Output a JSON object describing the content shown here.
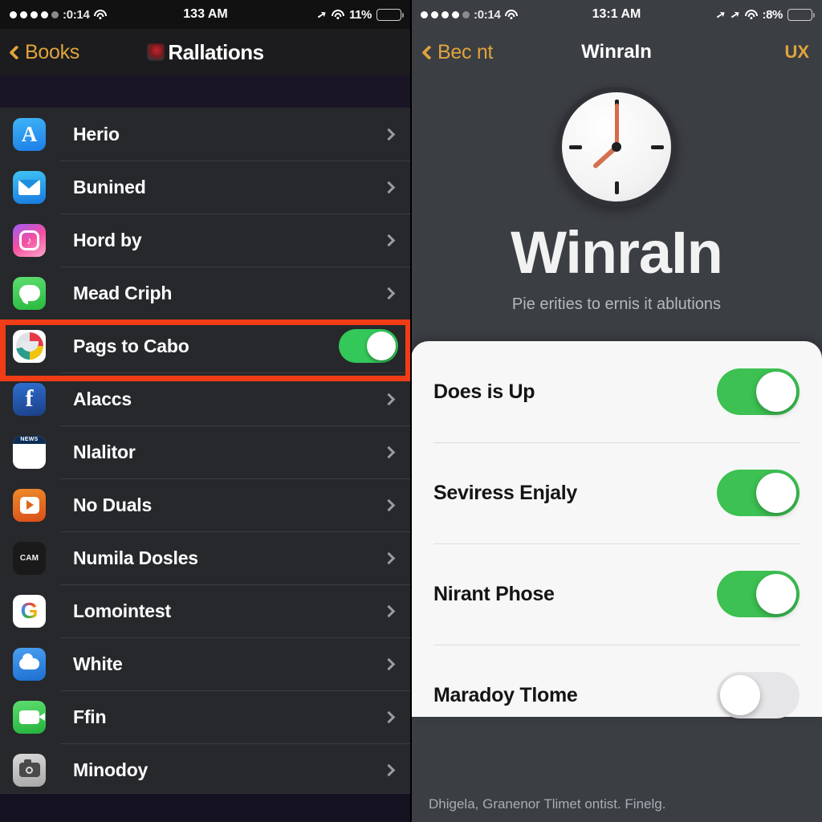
{
  "left": {
    "status_bar": {
      "carrier_dots": 5,
      "carrier_text": ":0:14",
      "wifi_icon": "wifi-icon",
      "time": "133 AM",
      "location_icon": "location-arrow-icon",
      "battery_percent": "11%",
      "battery_fill": 95,
      "battery_color": "#f5c518"
    },
    "nav": {
      "back_label": "Books",
      "back_icon": "chevron-left-icon",
      "title": "Rallations",
      "title_glyph": "app-badge-icon"
    },
    "rows": [
      {
        "label": "Herio",
        "icon": "appstore-icon",
        "accessory": "chevron"
      },
      {
        "label": "Bunined",
        "icon": "mail-icon",
        "accessory": "chevron"
      },
      {
        "label": "Hord by",
        "icon": "music-icon",
        "accessory": "chevron"
      },
      {
        "label": "Mead Criph",
        "icon": "messages-icon",
        "accessory": "chevron"
      },
      {
        "label": "Pags to Cabo",
        "icon": "maps-icon",
        "accessory": "switch",
        "on": true,
        "highlighted": true
      },
      {
        "label": "Alaccs",
        "icon": "facebook-icon",
        "accessory": "chevron"
      },
      {
        "label": "Nlalitor",
        "icon": "news-icon",
        "accessory": "chevron"
      },
      {
        "label": "No Duals",
        "icon": "youtube-icon",
        "accessory": "chevron"
      },
      {
        "label": "Numila Dosles",
        "icon": "camera-app-icon",
        "accessory": "chevron"
      },
      {
        "label": "Lomointest",
        "icon": "google-icon",
        "accessory": "chevron"
      },
      {
        "label": "White",
        "icon": "weather-icon",
        "accessory": "chevron"
      },
      {
        "label": "Ffin",
        "icon": "facetime-icon",
        "accessory": "chevron"
      },
      {
        "label": "Minodoy",
        "icon": "photos-icon",
        "accessory": "chevron"
      }
    ],
    "highlight_color": "#f03c17"
  },
  "right": {
    "status_bar": {
      "carrier_dots": 5,
      "carrier_text": ":0:14",
      "wifi_icon": "wifi-icon",
      "time": "13:1 AM",
      "location_icon": "location-arrow-icon",
      "battery_percent": ":8%",
      "battery_fill": 55,
      "battery_color": "#f5c518"
    },
    "nav": {
      "back_label": "Bec nt",
      "back_icon": "chevron-left-icon",
      "title": "WinraIn",
      "action_label": "UX"
    },
    "hero": {
      "clock_icon": "clock-icon",
      "title": "WinraIn",
      "subtitle": "Pie erities to ernis it ablutions"
    },
    "settings": [
      {
        "label": "Does is Up",
        "on": true
      },
      {
        "label": "Seviress Enjaly",
        "on": true
      },
      {
        "label": "Nirant Phose",
        "on": true
      },
      {
        "label": "Maradoy Tlome",
        "on": false
      }
    ],
    "footer": "Dhigela, Granenor Tlimet ontist. Finelg.",
    "accent_color": "#e0a43b",
    "toggle_on_color": "#3cc152"
  }
}
